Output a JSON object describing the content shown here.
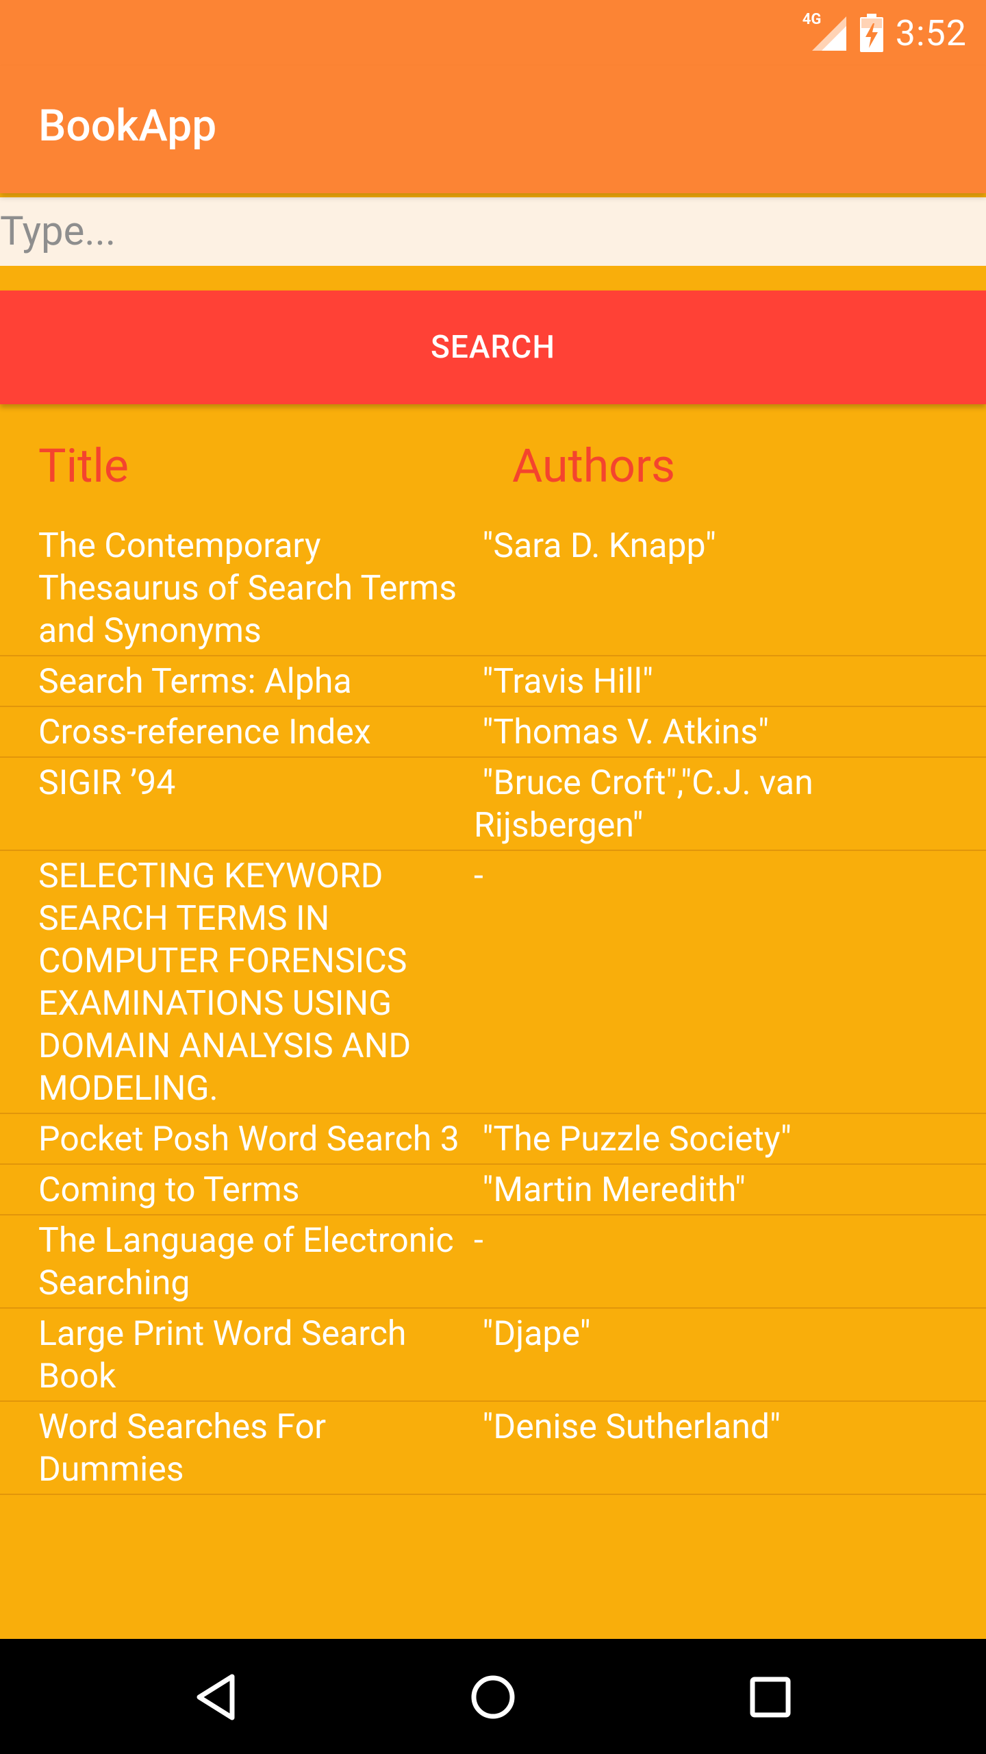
{
  "status_bar": {
    "network": "4G",
    "time": "3:52"
  },
  "app": {
    "title": "BookApp"
  },
  "search": {
    "placeholder": "Type...",
    "value": "",
    "button_label": "SEARCH"
  },
  "results": {
    "headers": {
      "title": "Title",
      "authors": "Authors"
    },
    "rows": [
      {
        "title": "The Contemporary Thesaurus of Search Terms and Synonyms",
        "authors": " \"Sara D. Knapp\""
      },
      {
        "title": "Search Terms: Alpha",
        "authors": " \"Travis Hill\""
      },
      {
        "title": "Cross-reference Index",
        "authors": " \"Thomas V. Atkins\""
      },
      {
        "title": "SIGIR ’94",
        "authors": " \"Bruce Croft\",\"C.J. van Rijsbergen\""
      },
      {
        "title": "SELECTING KEYWORD SEARCH TERMS IN COMPUTER FORENSICS EXAMINATIONS USING DOMAIN ANALYSIS AND MODELING.",
        "authors": "-"
      },
      {
        "title": "Pocket Posh Word Search 3",
        "authors": " \"The Puzzle Society\""
      },
      {
        "title": "Coming to Terms",
        "authors": " \"Martin Meredith\""
      },
      {
        "title": "The Language of Electronic Searching",
        "authors": "-"
      },
      {
        "title": "Large Print Word Search Book",
        "authors": " \"Djape\""
      },
      {
        "title": "Word Searches For Dummies",
        "authors": " \"Denise Sutherland\""
      }
    ]
  },
  "nav": {
    "back_icon": "back-triangle-icon",
    "home_icon": "home-circle-icon",
    "recents_icon": "recents-square-icon"
  },
  "colors": {
    "status_bar": "#FC8434",
    "app_bar": "#FC8434",
    "background": "#F9AE0B",
    "search_button": "#FF4136",
    "header_text": "#F4442E",
    "input_background": "#FDF1E3"
  }
}
